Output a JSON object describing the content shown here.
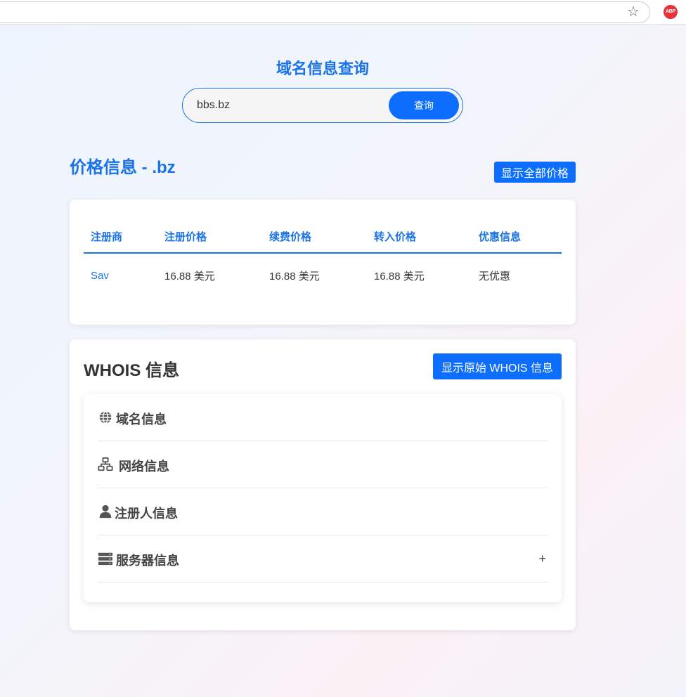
{
  "browser": {
    "icons": [
      "star-icon",
      "adblock-plus-icon"
    ],
    "extension_label": "ABP"
  },
  "header": {
    "title": "域名信息查询",
    "search_value": "bbs.bz",
    "search_button": "查询"
  },
  "price": {
    "title": "价格信息 - .bz",
    "show_all_button": "显示全部价格",
    "columns": [
      "注册商",
      "注册价格",
      "续费价格",
      "转入价格",
      "优惠信息"
    ],
    "rows": [
      {
        "registrar": "Sav",
        "register": "16.88 美元",
        "renew": "16.88 美元",
        "transfer": "16.88 美元",
        "promo": "无优惠"
      }
    ]
  },
  "whois": {
    "title": "WHOIS 信息",
    "raw_button": "显示原始 WHOIS 信息",
    "sections": [
      {
        "label": "域名信息",
        "icon": "globe-icon"
      },
      {
        "label": "网络信息",
        "icon": "network-icon"
      },
      {
        "label": "注册人信息",
        "icon": "user-icon"
      },
      {
        "label": "服务器信息",
        "icon": "server-icon",
        "toggle": "+"
      }
    ]
  },
  "colors": {
    "accent": "#1a73e8",
    "button": "#0d6efd",
    "text": "#333333"
  }
}
